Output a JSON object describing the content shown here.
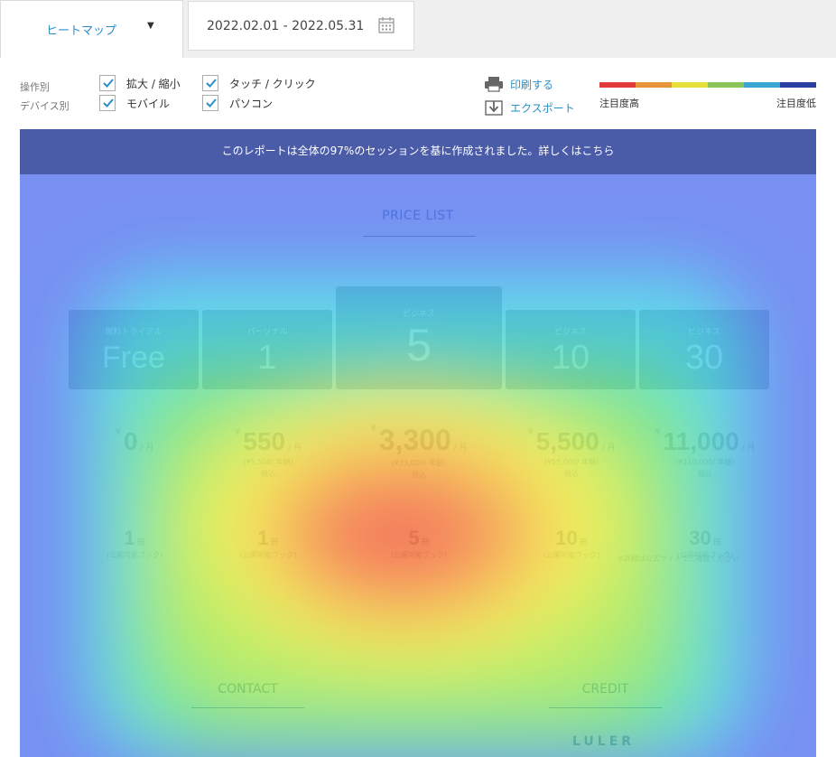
{
  "topbar": {
    "mode_label": "ヒートマップ",
    "mode_caret": "▼",
    "date_range": "2022.02.01 - 2022.05.31"
  },
  "filters": {
    "operation_label": "操作別",
    "device_label": "デバイス別",
    "zoom_label": "拡大 / 縮小",
    "touch_label": "タッチ / クリック",
    "mobile_label": "モバイル",
    "pc_label": "パソコン",
    "zoom_checked": true,
    "touch_checked": true,
    "mobile_checked": true,
    "pc_checked": true
  },
  "actions": {
    "print_label": "印刷する",
    "export_label": "エクスポート"
  },
  "legend": {
    "colors": [
      "#e03a3a",
      "#e8943a",
      "#e8e03a",
      "#8cc45a",
      "#3aa6d4",
      "#2a3fa0"
    ],
    "high_label": "注目度高",
    "low_label": "注目度低"
  },
  "notice": "このレポートは全体の97%のセッションを基に作成されました。詳しくはこちら",
  "page": {
    "title": "PRICE LIST",
    "plans": [
      {
        "sub": "無料トライアル",
        "big": "Free"
      },
      {
        "sub": "パーソナル",
        "big": "1"
      },
      {
        "sub": "ビジネス",
        "big": "5"
      },
      {
        "sub": "ビジネス",
        "big": "10"
      },
      {
        "sub": "ビジネス",
        "big": "30"
      }
    ],
    "prices": [
      {
        "yen": "¥",
        "amount": "0",
        "per": "/ 月",
        "note1": "",
        "note2": ""
      },
      {
        "yen": "¥",
        "amount": "550",
        "per": "/ 月",
        "note1": "(¥5,500/ 年額)",
        "note2": "税込"
      },
      {
        "yen": "¥",
        "amount": "3,300",
        "per": "/ 月",
        "note1": "(¥33,000/ 年額)",
        "note2": "税込"
      },
      {
        "yen": "¥",
        "amount": "5,500",
        "per": "/ 月",
        "note1": "(¥55,000/ 年額)",
        "note2": "税込"
      },
      {
        "yen": "¥",
        "amount": "11,000",
        "per": "/ 月",
        "note1": "(¥110,000/ 年額)",
        "note2": "税込"
      }
    ],
    "books": [
      {
        "num": "1",
        "unit": "冊",
        "note": "(公開可能ブック)"
      },
      {
        "num": "1",
        "unit": "冊",
        "note": "(公開可能ブック)"
      },
      {
        "num": "5",
        "unit": "冊",
        "note": "(公開可能ブック)"
      },
      {
        "num": "10",
        "unit": "冊",
        "note": "(公開可能ブック)"
      },
      {
        "num": "30",
        "unit": "冊",
        "note": "(公開可能ブック)"
      }
    ],
    "footnote": "※詳細は公式サイトでご確認ください",
    "contact_label": "CONTACT",
    "credit_label": "CREDIT",
    "logo_text": "LULER"
  }
}
